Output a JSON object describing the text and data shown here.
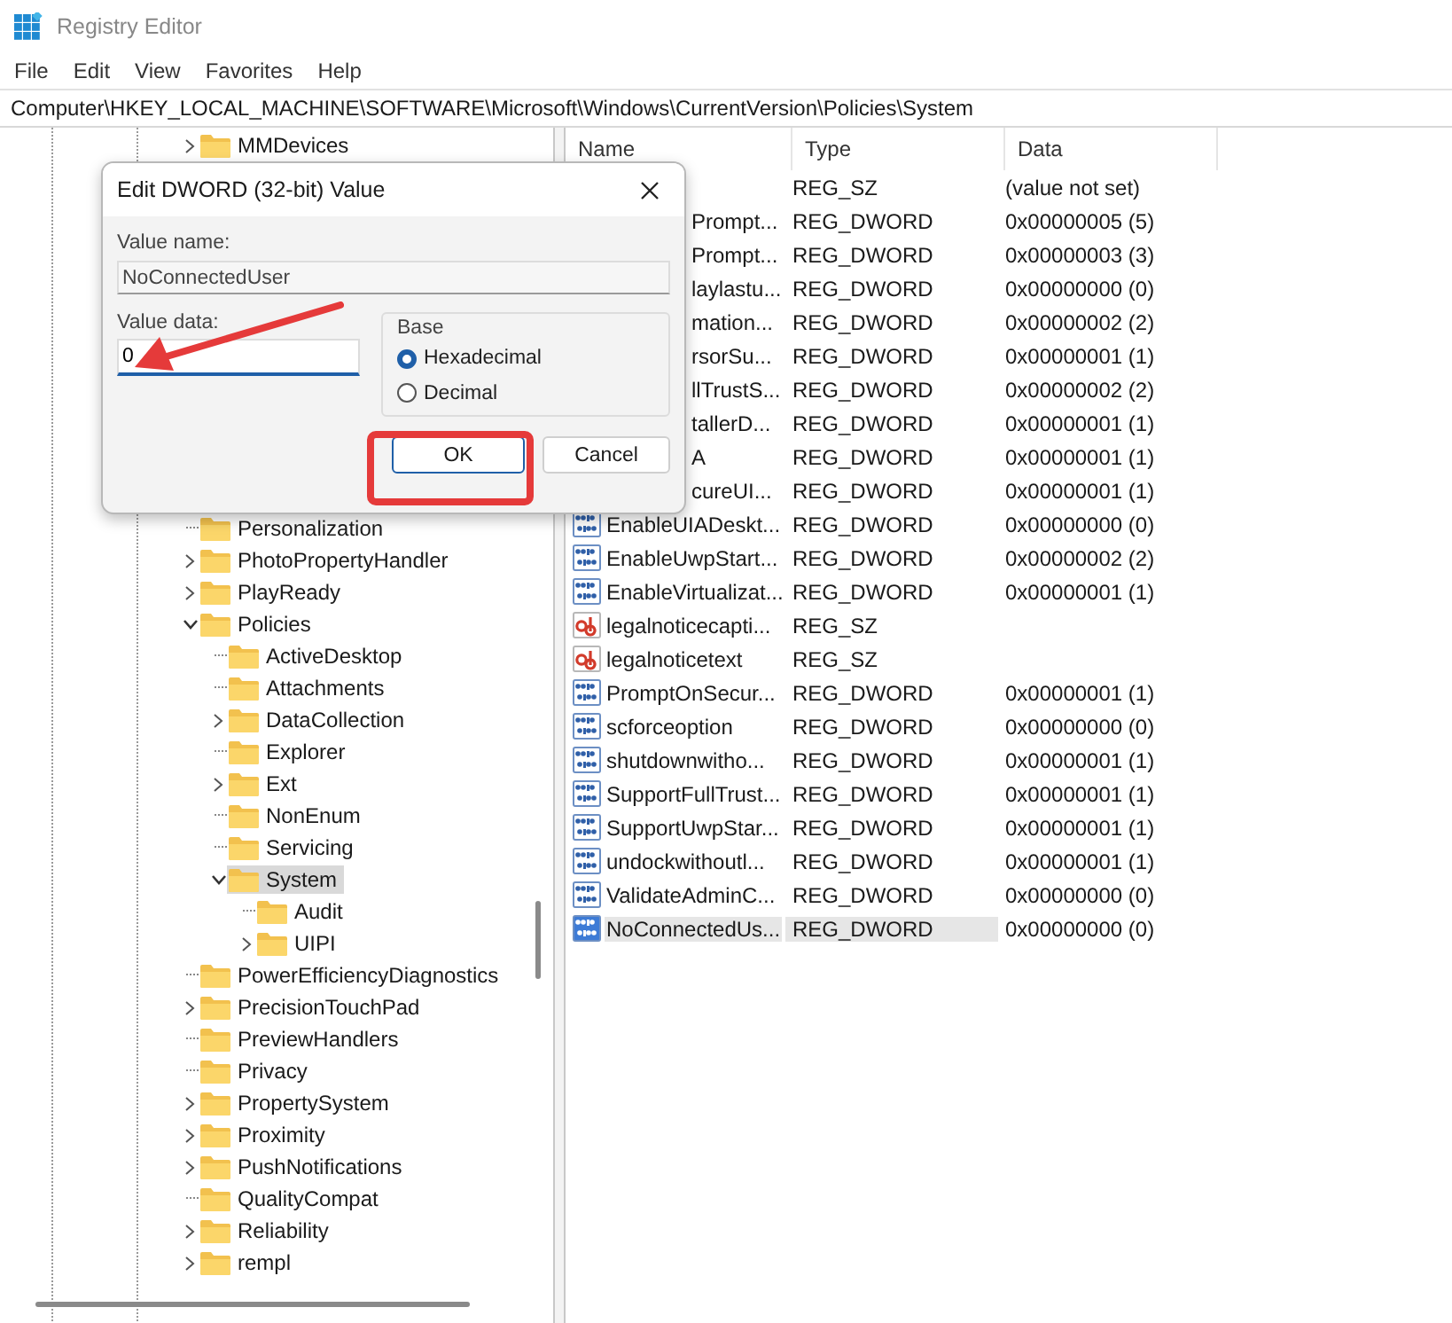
{
  "window": {
    "title": "Registry Editor"
  },
  "menu": [
    "File",
    "Edit",
    "View",
    "Favorites",
    "Help"
  ],
  "address": "Computer\\HKEY_LOCAL_MACHINE\\SOFTWARE\\Microsoft\\Windows\\CurrentVersion\\Policies\\System",
  "tree": [
    {
      "label": "MMDevices",
      "kind": "branch",
      "expanded": false,
      "selected": false
    },
    {
      "label": "Personalization",
      "kind": "leaf",
      "selected": false
    },
    {
      "label": "PhotoPropertyHandler",
      "kind": "branch",
      "expanded": false,
      "selected": false
    },
    {
      "label": "PlayReady",
      "kind": "branch",
      "expanded": false,
      "selected": false
    },
    {
      "label": "Policies",
      "kind": "branch",
      "expanded": true,
      "selected": false,
      "children": [
        {
          "label": "ActiveDesktop",
          "kind": "leaf",
          "selected": false
        },
        {
          "label": "Attachments",
          "kind": "leaf",
          "selected": false
        },
        {
          "label": "DataCollection",
          "kind": "branch",
          "expanded": false,
          "selected": false
        },
        {
          "label": "Explorer",
          "kind": "leaf",
          "selected": false
        },
        {
          "label": "Ext",
          "kind": "branch",
          "expanded": false,
          "selected": false
        },
        {
          "label": "NonEnum",
          "kind": "leaf",
          "selected": false
        },
        {
          "label": "Servicing",
          "kind": "leaf",
          "selected": false
        },
        {
          "label": "System",
          "kind": "branch",
          "expanded": true,
          "selected": true,
          "children": [
            {
              "label": "Audit",
              "kind": "leaf",
              "selected": false
            },
            {
              "label": "UIPI",
              "kind": "branch",
              "expanded": false,
              "selected": false
            }
          ]
        }
      ]
    },
    {
      "label": "PowerEfficiencyDiagnostics",
      "kind": "leaf",
      "selected": false
    },
    {
      "label": "PrecisionTouchPad",
      "kind": "branch",
      "expanded": false,
      "selected": false
    },
    {
      "label": "PreviewHandlers",
      "kind": "leaf",
      "selected": false
    },
    {
      "label": "Privacy",
      "kind": "leaf",
      "selected": false
    },
    {
      "label": "PropertySystem",
      "kind": "branch",
      "expanded": false,
      "selected": false
    },
    {
      "label": "Proximity",
      "kind": "branch",
      "expanded": false,
      "selected": false
    },
    {
      "label": "PushNotifications",
      "kind": "branch",
      "expanded": false,
      "selected": false
    },
    {
      "label": "QualityCompat",
      "kind": "leaf",
      "selected": false
    },
    {
      "label": "Reliability",
      "kind": "branch",
      "expanded": false,
      "selected": false
    },
    {
      "label": "rempl",
      "kind": "branch",
      "expanded": false,
      "selected": false
    }
  ],
  "values": {
    "columns": [
      "Name",
      "Type",
      "Data"
    ],
    "rows": [
      {
        "selected": false,
        "type": "REG_SZ",
        "data": "(value not set)"
      },
      {
        "selected": false,
        "name": "Prompt...",
        "type": "REG_DWORD",
        "data": "0x00000005 (5)"
      },
      {
        "selected": false,
        "name": "Prompt...",
        "type": "REG_DWORD",
        "data": "0x00000003 (3)"
      },
      {
        "selected": false,
        "name": "laylastu...",
        "type": "REG_DWORD",
        "data": "0x00000000 (0)"
      },
      {
        "selected": false,
        "name": "mation...",
        "type": "REG_DWORD",
        "data": "0x00000002 (2)"
      },
      {
        "selected": false,
        "name": "rsorSu...",
        "type": "REG_DWORD",
        "data": "0x00000001 (1)"
      },
      {
        "selected": false,
        "name": "llTrustS...",
        "type": "REG_DWORD",
        "data": "0x00000002 (2)"
      },
      {
        "selected": false,
        "name": "tallerD...",
        "type": "REG_DWORD",
        "data": "0x00000001 (1)"
      },
      {
        "selected": false,
        "name": "A",
        "type": "REG_DWORD",
        "data": "0x00000001 (1)"
      },
      {
        "selected": false,
        "name": "cureUI...",
        "type": "REG_DWORD",
        "data": "0x00000001 (1)"
      },
      {
        "kind": "dword",
        "selected": false,
        "name": "EnableUIADeskt...",
        "type": "REG_DWORD",
        "data": "0x00000000 (0)"
      },
      {
        "kind": "dword",
        "selected": false,
        "name": "EnableUwpStart...",
        "type": "REG_DWORD",
        "data": "0x00000002 (2)"
      },
      {
        "kind": "dword",
        "selected": false,
        "name": "EnableVirtualizat...",
        "type": "REG_DWORD",
        "data": "0x00000001 (1)"
      },
      {
        "kind": "sz",
        "selected": false,
        "name": "legalnoticecapti...",
        "type": "REG_SZ"
      },
      {
        "kind": "sz",
        "selected": false,
        "name": "legalnoticetext",
        "type": "REG_SZ"
      },
      {
        "kind": "dword",
        "selected": false,
        "name": "PromptOnSecur...",
        "type": "REG_DWORD",
        "data": "0x00000001 (1)"
      },
      {
        "kind": "dword",
        "selected": false,
        "name": "scforceoption",
        "type": "REG_DWORD",
        "data": "0x00000000 (0)"
      },
      {
        "kind": "dword",
        "selected": false,
        "name": "shutdownwitho...",
        "type": "REG_DWORD",
        "data": "0x00000001 (1)"
      },
      {
        "kind": "dword",
        "selected": false,
        "name": "SupportFullTrust...",
        "type": "REG_DWORD",
        "data": "0x00000001 (1)"
      },
      {
        "kind": "dword",
        "selected": false,
        "name": "SupportUwpStar...",
        "type": "REG_DWORD",
        "data": "0x00000001 (1)"
      },
      {
        "kind": "dword",
        "selected": false,
        "name": "undockwithoutl...",
        "type": "REG_DWORD",
        "data": "0x00000001 (1)"
      },
      {
        "kind": "dword",
        "selected": false,
        "name": "ValidateAdminC...",
        "type": "REG_DWORD",
        "data": "0x00000000 (0)"
      },
      {
        "kind": "dword",
        "selected": true,
        "name": "NoConnectedUs...",
        "type": "REG_DWORD",
        "data": "0x00000000 (0)"
      }
    ]
  },
  "dialog": {
    "title": "Edit DWORD (32-bit) Value",
    "value_name_label": "Value name:",
    "value_name": "NoConnectedUser",
    "value_data_label": "Value data:",
    "value_data": "0",
    "base_label": "Base",
    "base_options": [
      {
        "label": "Hexadecimal",
        "selected": true
      },
      {
        "label": "Decimal",
        "selected": false
      }
    ],
    "buttons": [
      {
        "label": "OK",
        "kind": "default"
      },
      {
        "label": "Cancel",
        "kind": "normal"
      }
    ]
  }
}
